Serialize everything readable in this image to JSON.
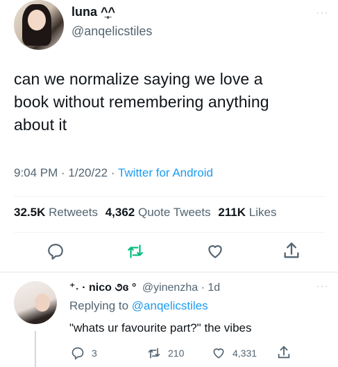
{
  "tweet": {
    "author_name": "luna ^̲̥^",
    "author_handle": "@anqelicstiles",
    "more_glyph": "···",
    "text_lines": [
      "can we normalize saying we love a",
      "book without remembering anything",
      "about it"
    ],
    "time_date": "9:04 PM · 1/20/22 · ",
    "source": "Twitter for Android",
    "stats": {
      "retweets_count": "32.5K",
      "retweets_label": "Retweets",
      "quotes_count": "4,362",
      "quotes_label": "Quote Tweets",
      "likes_count": "211K",
      "likes_label": "Likes"
    },
    "icons": [
      "reply-icon",
      "retweet-icon",
      "like-icon",
      "share-icon"
    ]
  },
  "reply": {
    "author_name": "⁺˖ · nico ૭ɞ °",
    "author_handle": "@yinenzha · 1d",
    "more_glyph": "···",
    "replying_prefix": "Replying to ",
    "replying_handle": "@anqelicstiles",
    "text": "\"whats ur favourite part?\" the vibes",
    "reply_count": "3",
    "retweet_count": "210",
    "like_count": "4,331"
  },
  "colors": {
    "accent": "#1d9bf0",
    "retweet_green": "#00ba7c",
    "muted": "#536471",
    "text": "#0f1419"
  }
}
